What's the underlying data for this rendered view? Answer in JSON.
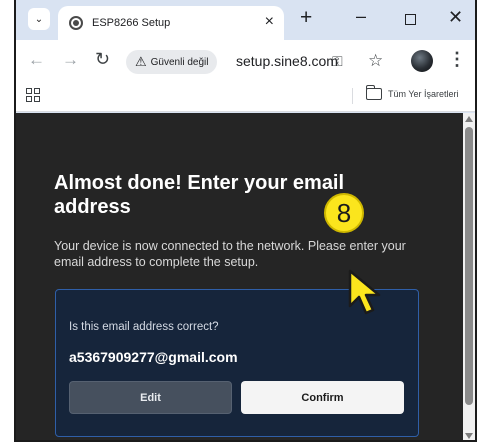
{
  "browser": {
    "tab": {
      "title": "ESP8266 Setup",
      "close_glyph": "×"
    },
    "new_tab_glyph": "+",
    "window_controls": {
      "minimize": "–",
      "close": "✕"
    },
    "tab_search_glyph": "⌄",
    "toolbar": {
      "back_glyph": "←",
      "forward_glyph": "→",
      "reload_glyph": "↻",
      "security_warning": "Güvenli değil",
      "warning_glyph": "⚠",
      "url": "setup.sine8.com",
      "key_glyph": "⚿",
      "star_glyph": "☆",
      "menu_glyph": "⋮"
    },
    "bookmarks_bar": {
      "folder_label": "Tüm Yer İşaretleri"
    }
  },
  "page": {
    "title": "Almost done! Enter your email address",
    "description": "Your device is now connected to the network. Please enter your email address to complete the setup.",
    "card": {
      "question": "Is this email address correct?",
      "email": "a5367909277@gmail.com",
      "edit_label": "Edit",
      "confirm_label": "Confirm"
    }
  },
  "annotation": {
    "step_number": "8",
    "badge_color": "#fbe51d"
  },
  "colors": {
    "page_background": "#252525",
    "card_background": "#16253b",
    "card_border": "#2f5fa8",
    "chrome_tabstrip": "#d9e3f2"
  }
}
